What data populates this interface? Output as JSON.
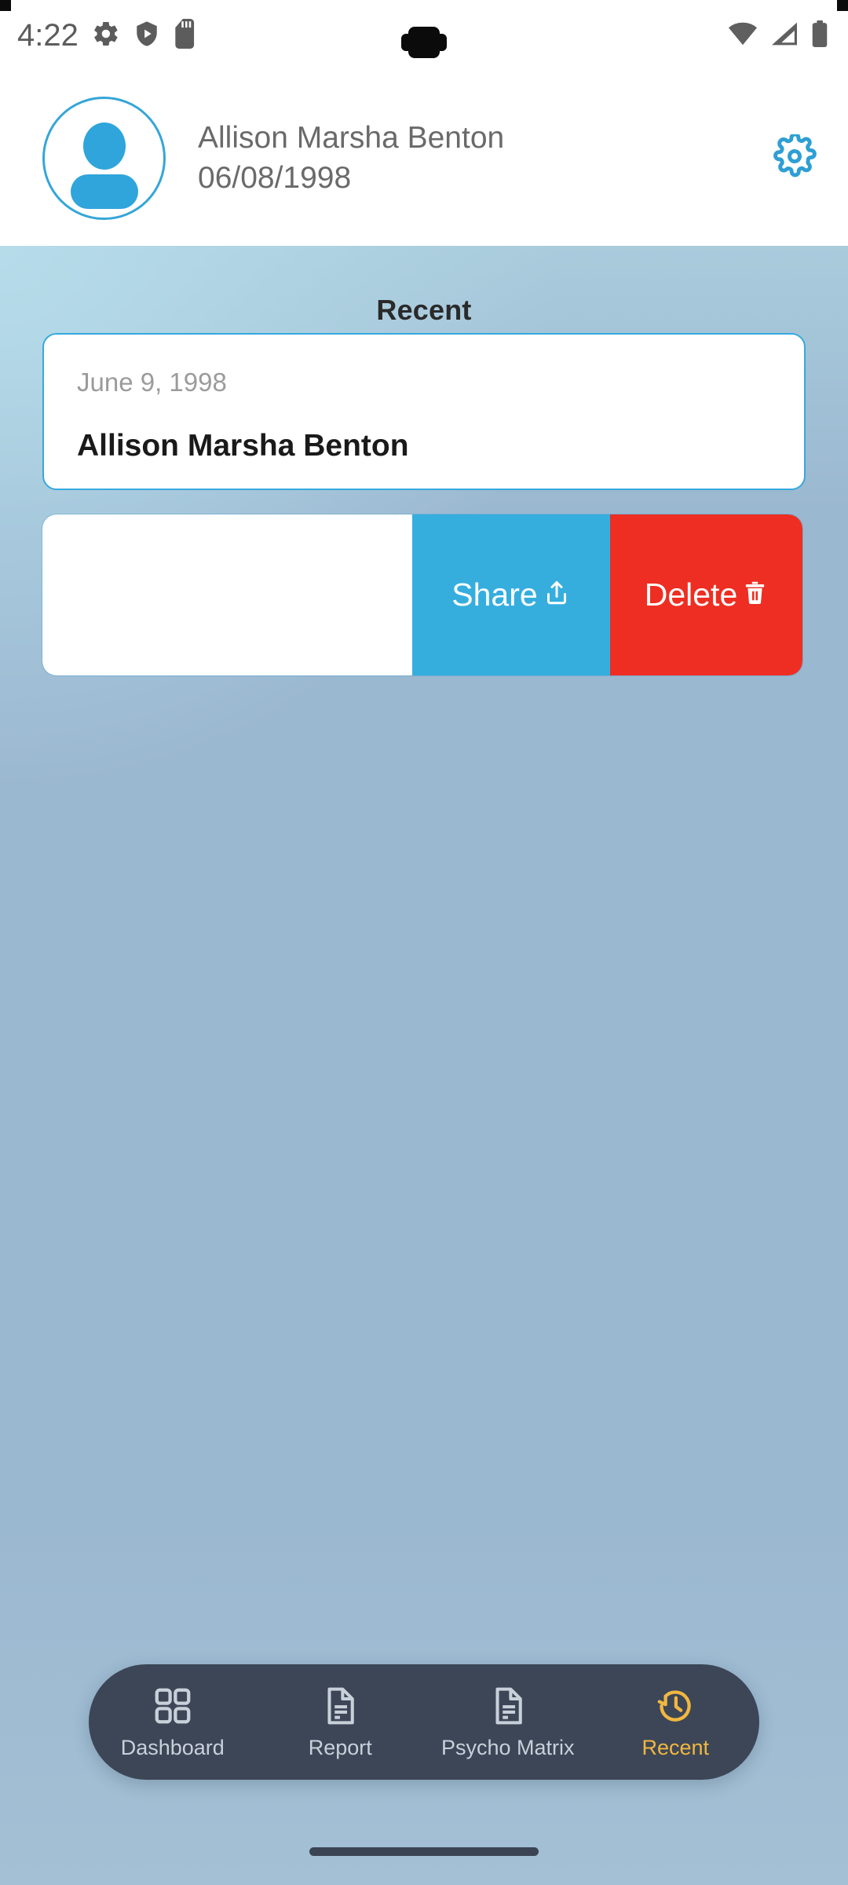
{
  "status_bar": {
    "time": "4:22",
    "left_icons": [
      "gear-icon",
      "play-protect-shield-icon",
      "sd-card-icon"
    ],
    "right_icons": [
      "wifi-icon",
      "cellular-signal-icon",
      "battery-icon"
    ]
  },
  "profile_header": {
    "avatar_icon": "person-avatar-icon",
    "name": "Allison Marsha Benton",
    "dob": "06/08/1998",
    "settings_icon": "gear-icon"
  },
  "main": {
    "section_title": "Recent",
    "recent_card": {
      "date": "June 9, 1998",
      "name": "Allison Marsha Benton"
    },
    "swipe_actions": {
      "share_label": "Share",
      "share_icon": "share-upload-icon",
      "delete_label": "Delete",
      "delete_icon": "trash-icon"
    }
  },
  "bottom_nav": {
    "items": [
      {
        "label": "Dashboard",
        "icon": "grid-icon",
        "active": false
      },
      {
        "label": "Report",
        "icon": "document-icon",
        "active": false
      },
      {
        "label": "Psycho Matrix",
        "icon": "document-icon",
        "active": false
      },
      {
        "label": "Recent",
        "icon": "history-clock-icon",
        "active": true
      }
    ]
  },
  "colors": {
    "accent_blue": "#35AEDE",
    "delete_red": "#EE2E22",
    "active_nav": "#F1B73F",
    "nav_bar_bg": "#3C4657",
    "background_top": "#A9CBDC",
    "background_bottom": "#9BB8D1"
  }
}
